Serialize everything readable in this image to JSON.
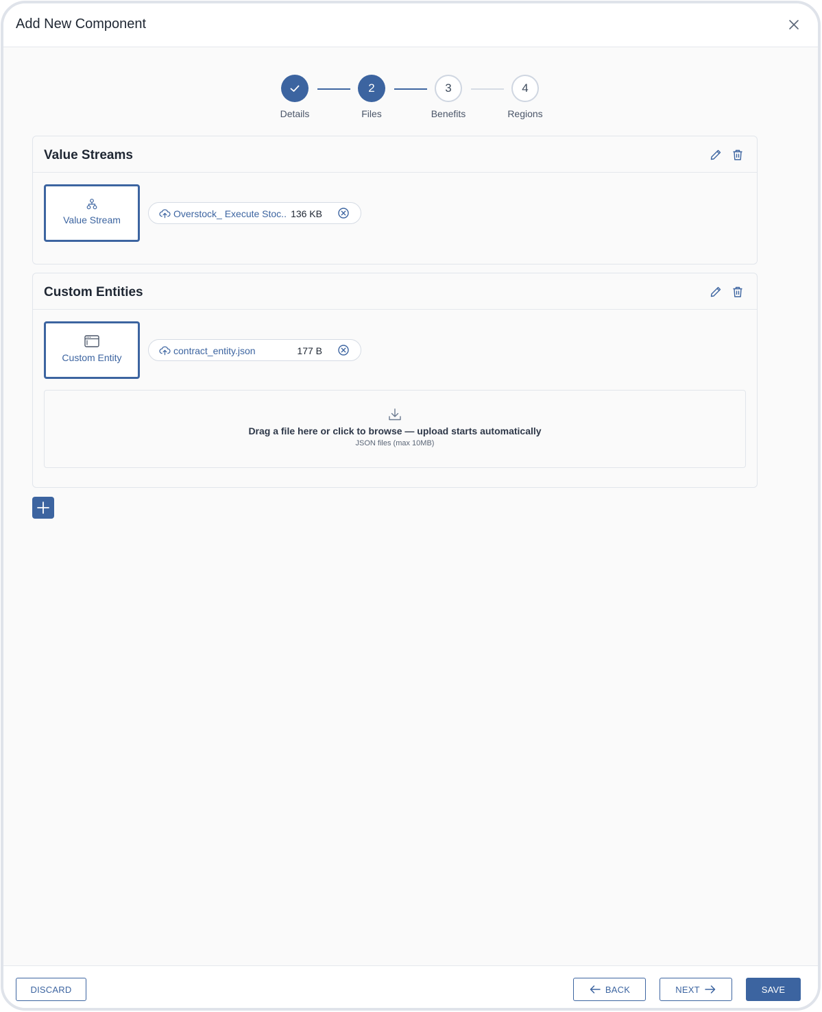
{
  "dialog": {
    "title": "Add New Component"
  },
  "stepper": {
    "steps": [
      {
        "label": "Details",
        "number": "1",
        "status": "done"
      },
      {
        "label": "Files",
        "number": "2",
        "status": "active"
      },
      {
        "label": "Benefits",
        "number": "3",
        "status": "pending"
      },
      {
        "label": "Regions",
        "number": "4",
        "status": "pending"
      }
    ]
  },
  "sections": [
    {
      "title": "Value Streams",
      "card_label": "Value Stream",
      "card_icon": "hierarchy-icon",
      "file": {
        "name": "Overstock_ Execute Stoc...",
        "size": "136 KB"
      }
    },
    {
      "title": "Custom Entities",
      "card_label": "Custom Entity",
      "card_icon": "window-icon",
      "file": {
        "name": "contract_entity.json",
        "size": "177 B"
      },
      "dropzone": {
        "text": "Drag a file here or click to browse — upload starts automatically",
        "hint": "JSON files (max 10MB)"
      }
    }
  ],
  "footer": {
    "discard_label": "DISCARD",
    "back_label": "BACK",
    "next_label": "NEXT",
    "save_label": "SAVE"
  },
  "colors": {
    "primary": "#3c64a0",
    "border": "#e1e5eb",
    "background": "#fafafa"
  }
}
